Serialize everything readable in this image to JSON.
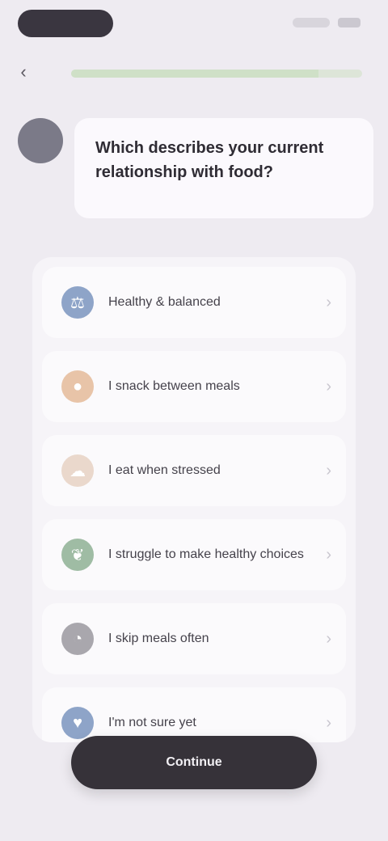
{
  "header": {
    "back_label": "‹",
    "progress_fraction": 0.85
  },
  "colors": {
    "avatar": "#7b7a88",
    "cta": "#363239",
    "progress": "#cfe0c7"
  },
  "question": {
    "text": "Which describes your current relationship with food?"
  },
  "options": [
    {
      "icon": "scale-icon",
      "glyph": "⚖",
      "color": "#8ea4c8",
      "label": "Healthy & balanced"
    },
    {
      "icon": "snack-icon",
      "glyph": "●",
      "color": "#e8c4a8",
      "label": "I snack between meals"
    },
    {
      "icon": "stress-icon",
      "glyph": "☁",
      "color": "#ead8cc",
      "label": "I eat when stressed"
    },
    {
      "icon": "leaf-icon",
      "glyph": "❦",
      "color": "#9fbca4",
      "label": "I struggle to make healthy choices"
    },
    {
      "icon": "clock-icon",
      "glyph": "◔",
      "color": "#a9a7ad",
      "label": "I skip meals often"
    },
    {
      "icon": "heart-icon",
      "glyph": "♥",
      "color": "#8ea4c8",
      "label": "I'm not sure yet"
    }
  ],
  "cta": {
    "label": "Continue"
  }
}
